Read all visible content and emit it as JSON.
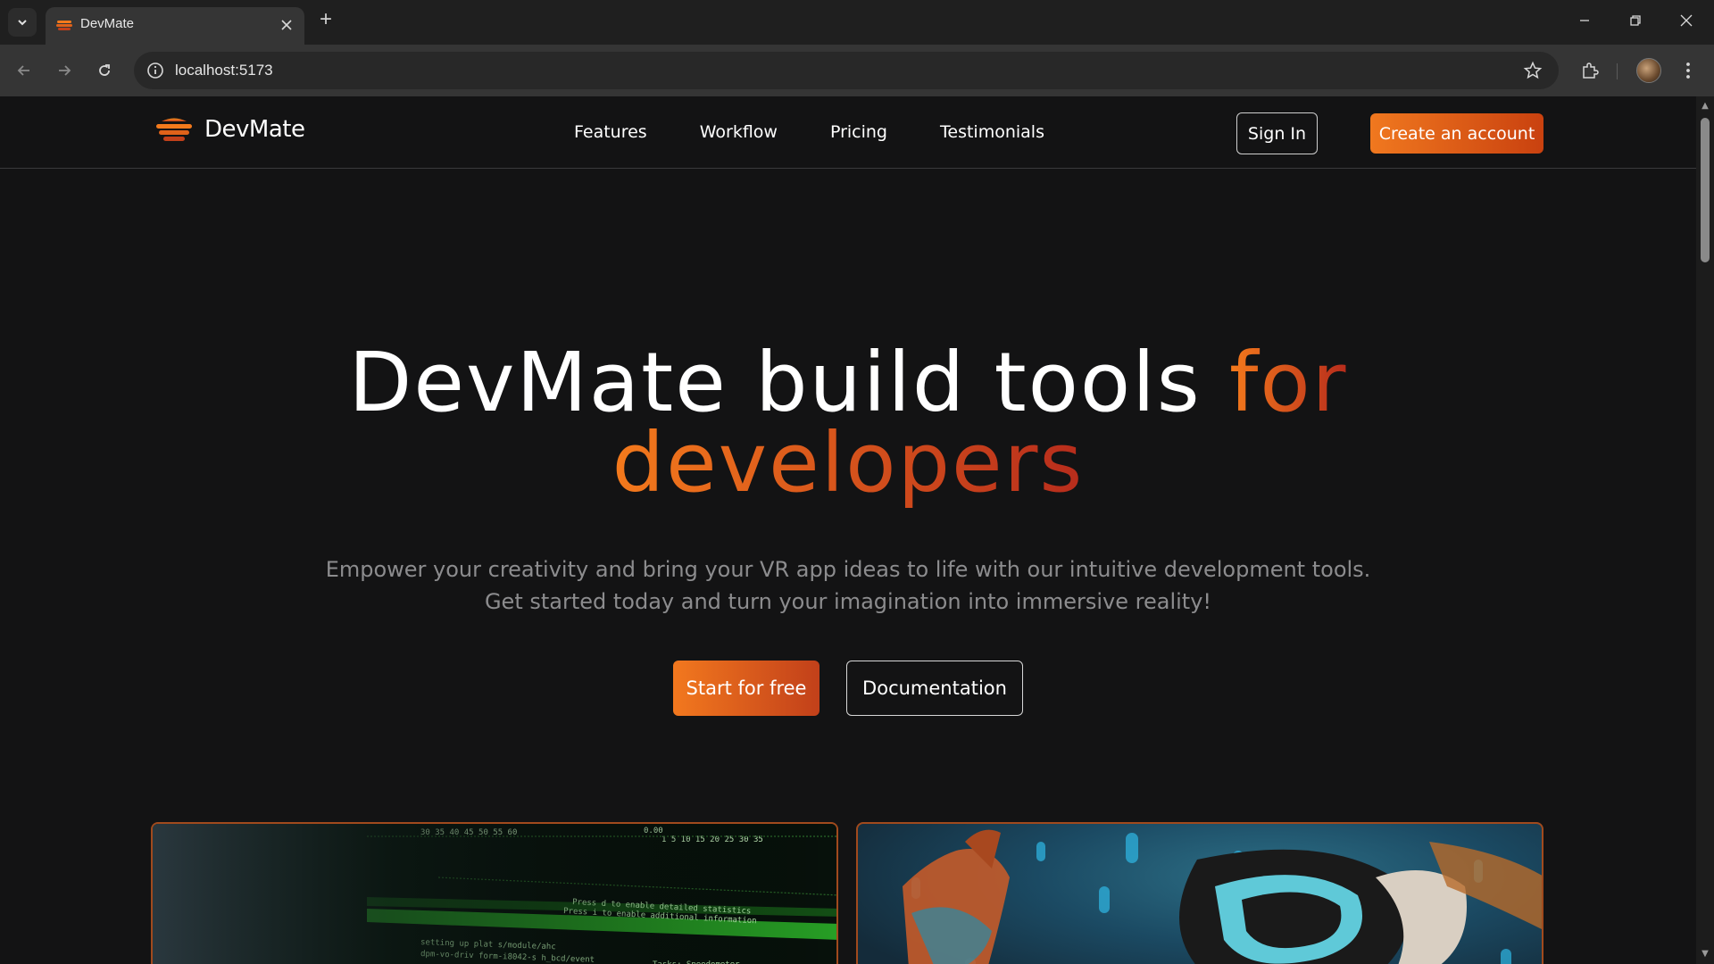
{
  "browser": {
    "tab_title": "DevMate",
    "new_tab_label": "+",
    "url": "localhost:5173"
  },
  "site": {
    "brand": "DevMate",
    "nav": [
      "Features",
      "Workflow",
      "Pricing",
      "Testimonials"
    ],
    "signin_label": "Sign In",
    "create_account_label": "Create an account"
  },
  "hero": {
    "title_part1": "DevMate build tools ",
    "title_accent1": "for",
    "title_accent2": "developers",
    "subtitle_line1": "Empower your creativity and bring your VR app ideas to life with our intuitive development tools.",
    "subtitle_line2": "Get started today and turn your imagination into immersive reality!",
    "primary_cta": "Start for free",
    "secondary_cta": "Documentation"
  },
  "cards": [
    {
      "image": "terminal-code-photo"
    },
    {
      "image": "vr-headset-hand-photo"
    }
  ],
  "colors": {
    "accent_start": "#f47a1c",
    "accent_end": "#b72c1c",
    "background": "#131314"
  }
}
